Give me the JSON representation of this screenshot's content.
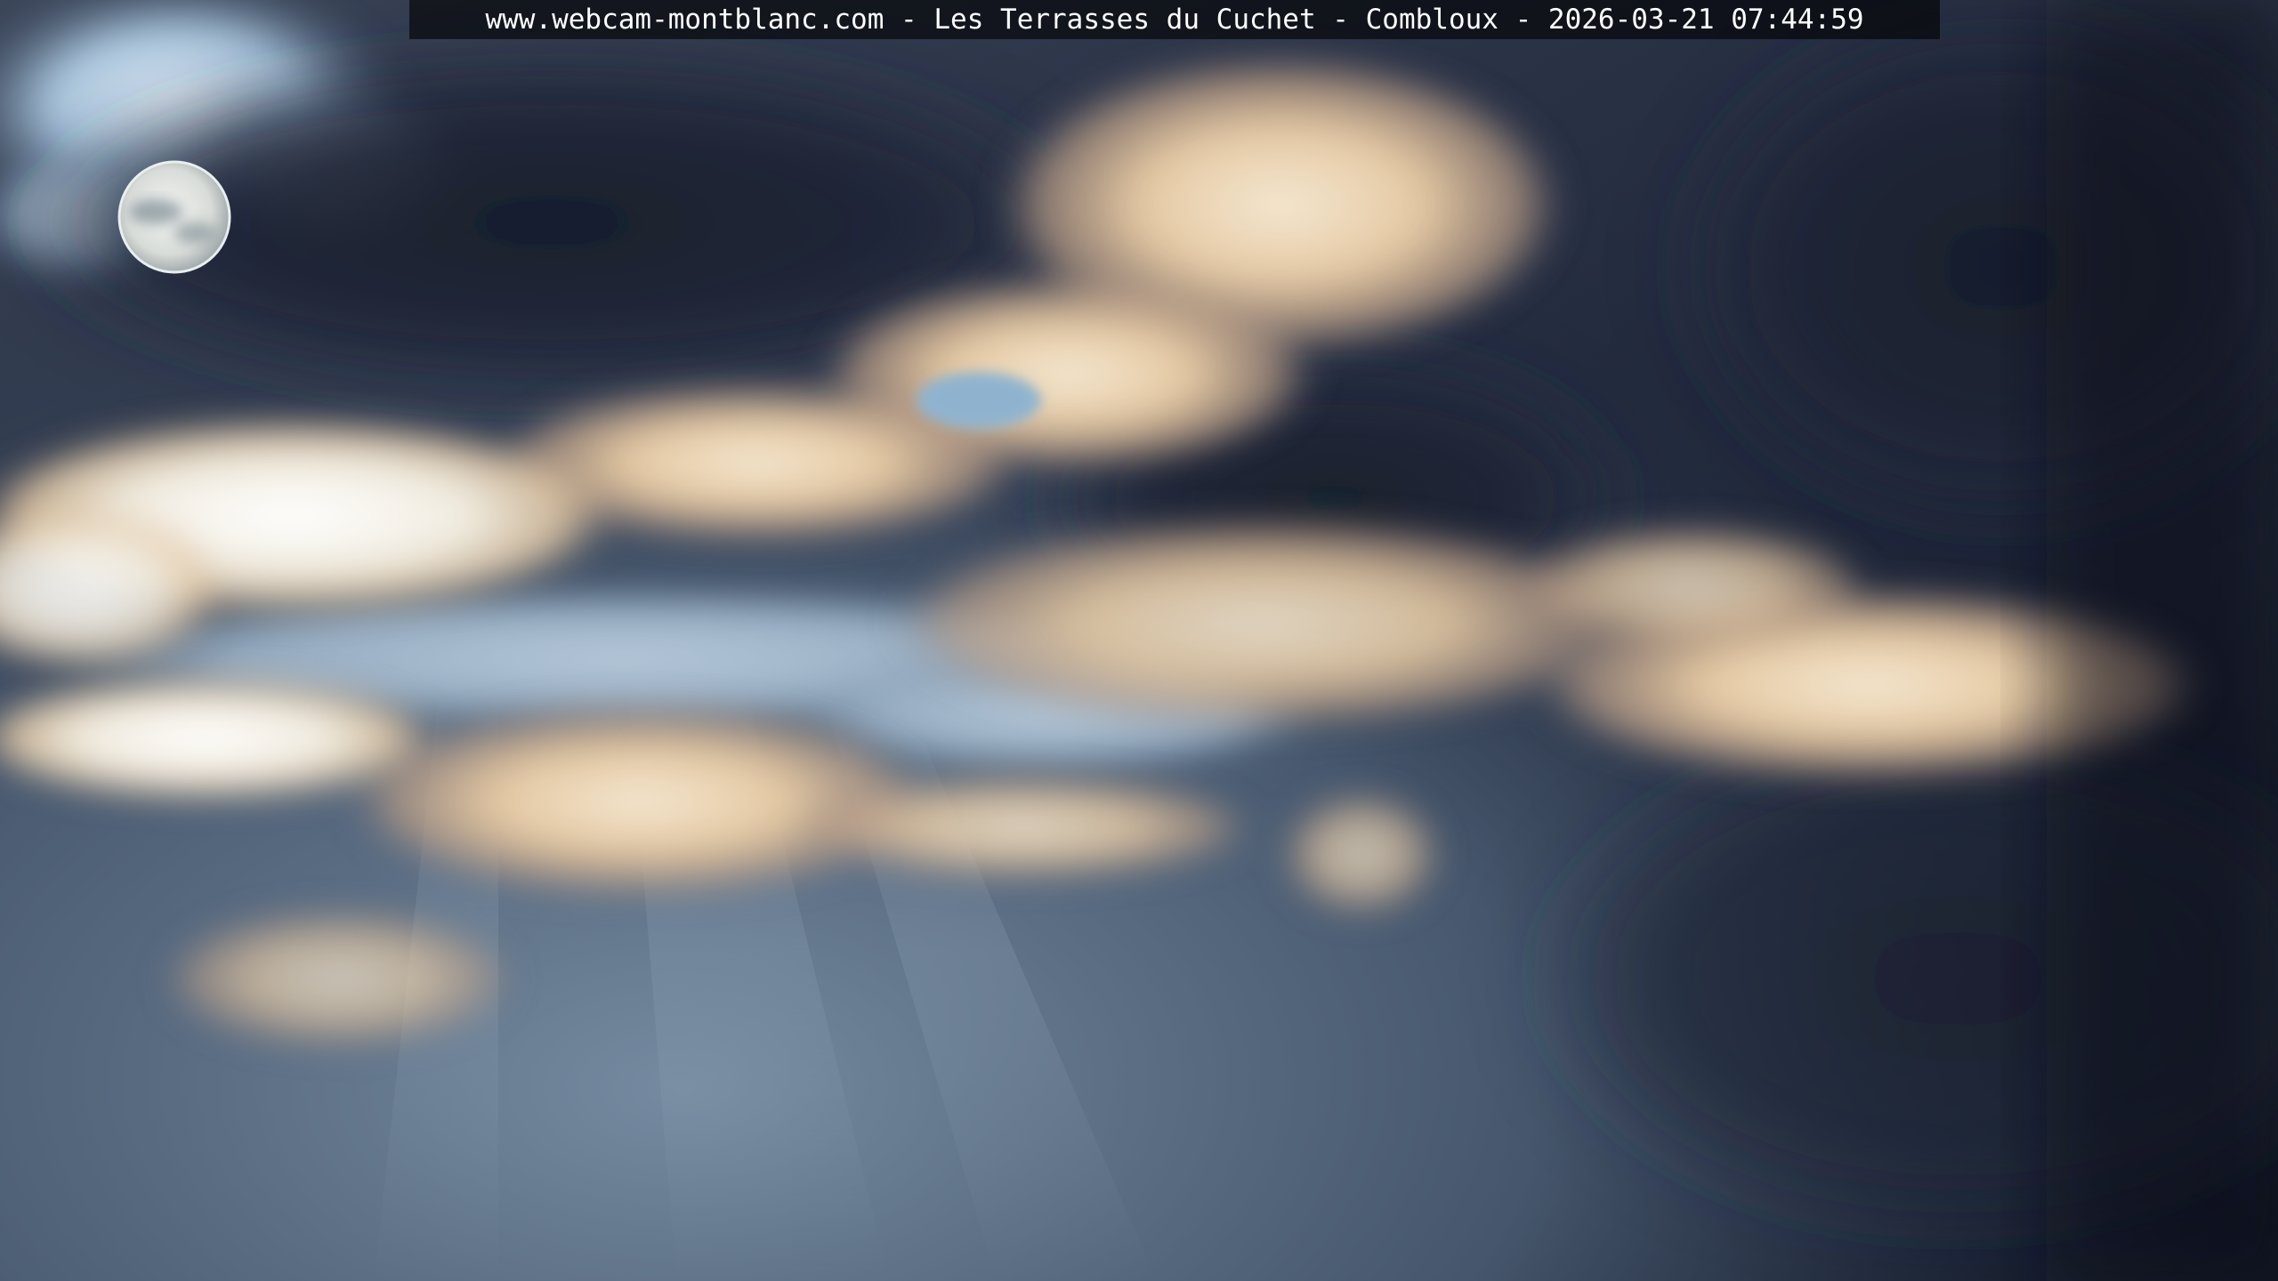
{
  "overlay": {
    "caption": "www.webcam-montblanc.com - Les Terrasses du Cuchet - Combloux - 2026-03-21 07:44:59"
  },
  "scene": {
    "subject": "webcam sky view",
    "colors": {
      "dark_cloud": "#1f2638",
      "deep_sky": "#0e1424",
      "haze": "#6f8499",
      "bright_cloud": "#f4efe2",
      "warm_edge": "#e8c9a0",
      "pale_blue": "#b9d3e6"
    }
  }
}
